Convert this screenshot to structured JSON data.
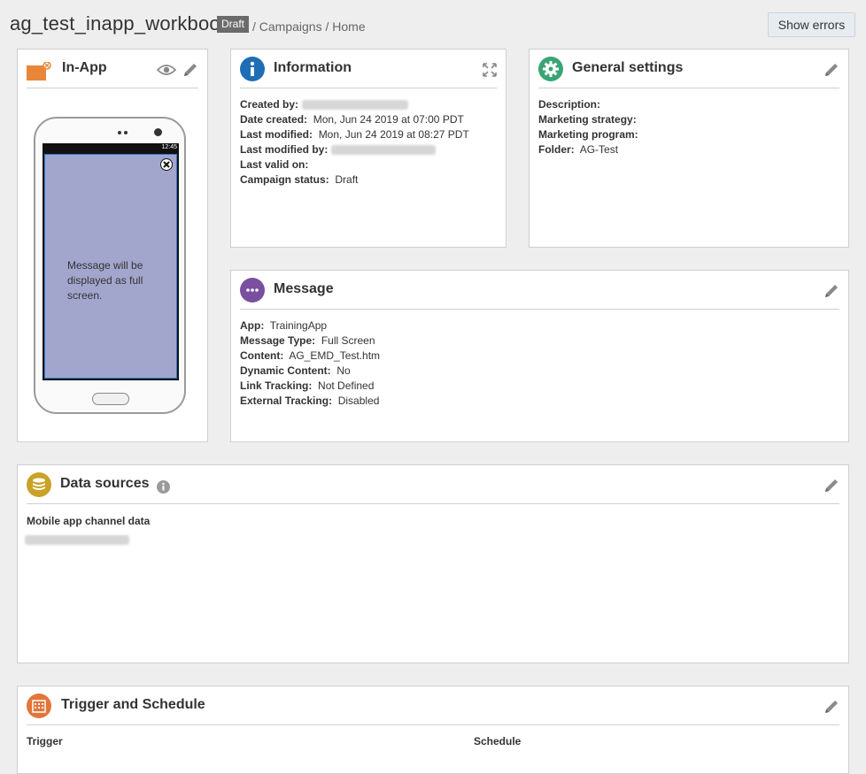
{
  "page": {
    "title": "ag_test_inapp_workbook",
    "status_badge": "Draft",
    "breadcrumb": [
      "/ Campaigns",
      "/ Home"
    ],
    "show_errors_label": "Show errors"
  },
  "inapp": {
    "title": "In-App",
    "phone_time": "12:45",
    "message": "Message will be displayed as full screen."
  },
  "information": {
    "title": "Information",
    "fields": [
      {
        "label": "Created by:",
        "value": ""
      },
      {
        "label": "Date created:",
        "value": "Mon, Jun 24 2019 at 07:00 PDT"
      },
      {
        "label": "Last modified:",
        "value": "Mon, Jun 24 2019 at 08:27 PDT"
      },
      {
        "label": "Last modified by:",
        "value": ""
      },
      {
        "label": "Last valid on:",
        "value": ""
      },
      {
        "label": "Campaign status:",
        "value": "Draft"
      }
    ]
  },
  "general_settings": {
    "title": "General settings",
    "fields": [
      {
        "label": "Description:",
        "value": ""
      },
      {
        "label": "Marketing strategy:",
        "value": ""
      },
      {
        "label": "Marketing program:",
        "value": ""
      },
      {
        "label": "Folder:",
        "value": "AG-Test"
      }
    ]
  },
  "message": {
    "title": "Message",
    "fields": [
      {
        "label": "App:",
        "value": "TrainingApp"
      },
      {
        "label": "Message Type:",
        "value": "Full Screen"
      },
      {
        "label": "Content:",
        "value": "AG_EMD_Test.htm"
      },
      {
        "label": "Dynamic Content:",
        "value": "No"
      },
      {
        "label": "Link Tracking:",
        "value": "Not Defined"
      },
      {
        "label": "External Tracking:",
        "value": "Disabled"
      }
    ]
  },
  "data_sources": {
    "title": "Data sources",
    "subtitle": "Mobile app channel data",
    "value": ""
  },
  "trigger_schedule": {
    "title": "Trigger and Schedule",
    "trigger_label": "Trigger",
    "schedule_label": "Schedule"
  },
  "colors": {
    "info_blue": "#1f6db5",
    "settings_green": "#3aa574",
    "message_purple": "#7a4fa0",
    "datasource_gold": "#c9a227",
    "trigger_orange": "#e2763a",
    "inapp_orange": "#e8873a"
  }
}
